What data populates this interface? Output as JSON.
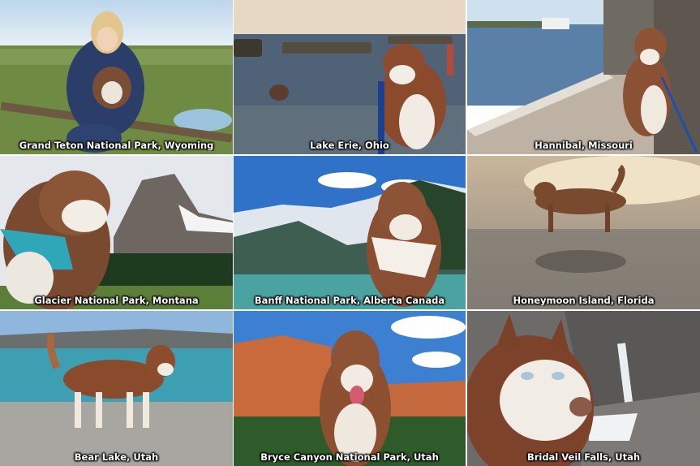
{
  "gallery": {
    "photos": [
      {
        "caption": "Grand Teton National Park, Wyoming"
      },
      {
        "caption": "Lake Erie, Ohio"
      },
      {
        "caption": "Hannibal, Missouri"
      },
      {
        "caption": "Glacier National Park, Montana"
      },
      {
        "caption": "Banff National Park, Alberta Canada"
      },
      {
        "caption": "Honeymoon Island, Florida"
      },
      {
        "caption": "Bear Lake, Utah"
      },
      {
        "caption": "Bryce Canyon National Park, Utah"
      },
      {
        "caption": "Bridal Veil Falls, Utah"
      }
    ]
  }
}
